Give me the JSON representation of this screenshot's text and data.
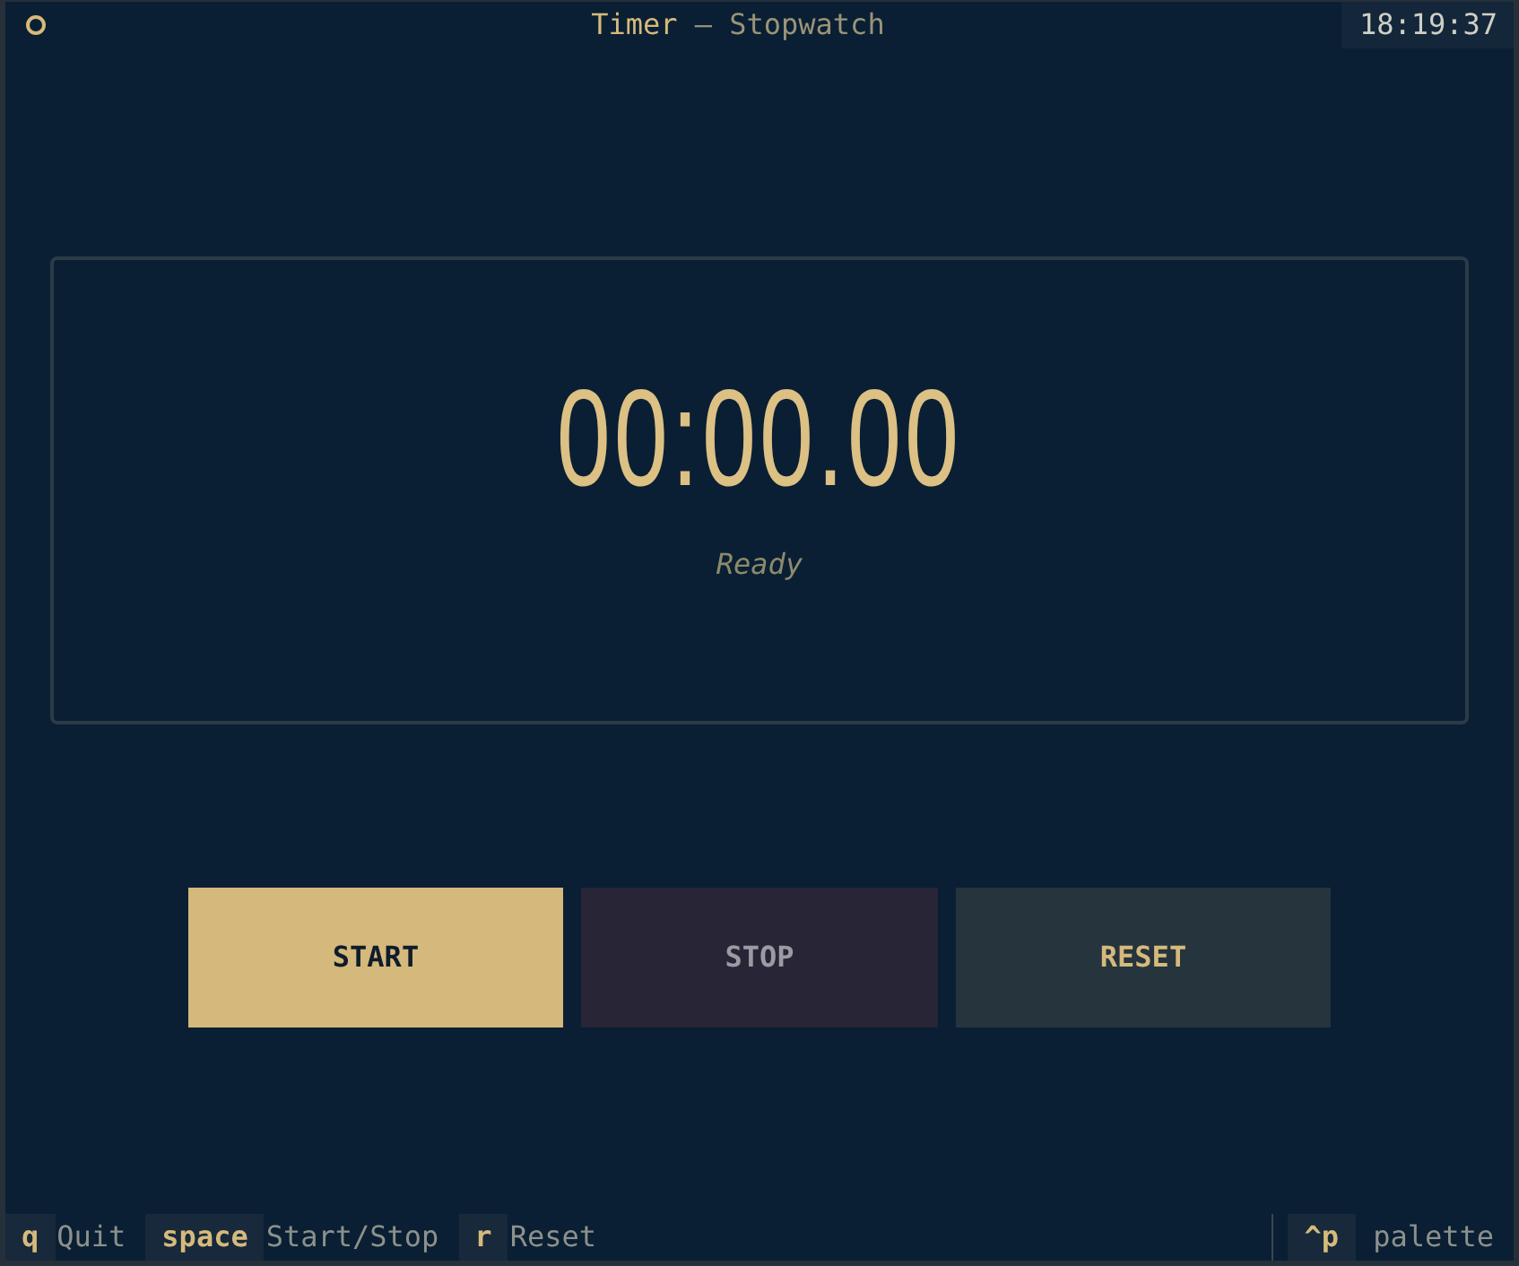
{
  "header": {
    "title": "Timer",
    "subtitle": "— Stopwatch",
    "clock": "18:19:37"
  },
  "display": {
    "time": "00:00.00",
    "status": "Ready"
  },
  "buttons": [
    {
      "label": "START",
      "kind": "primary",
      "disabled": false
    },
    {
      "label": "STOP",
      "kind": "error",
      "disabled": true
    },
    {
      "label": "RESET",
      "kind": "default",
      "disabled": false
    }
  ],
  "footer": {
    "bindings": [
      {
        "key": "q",
        "description": "Quit"
      },
      {
        "key": "space",
        "description": "Start/Stop"
      },
      {
        "key": "r",
        "description": "Reset"
      }
    ],
    "palette": {
      "key": "^p",
      "description": "palette"
    }
  }
}
